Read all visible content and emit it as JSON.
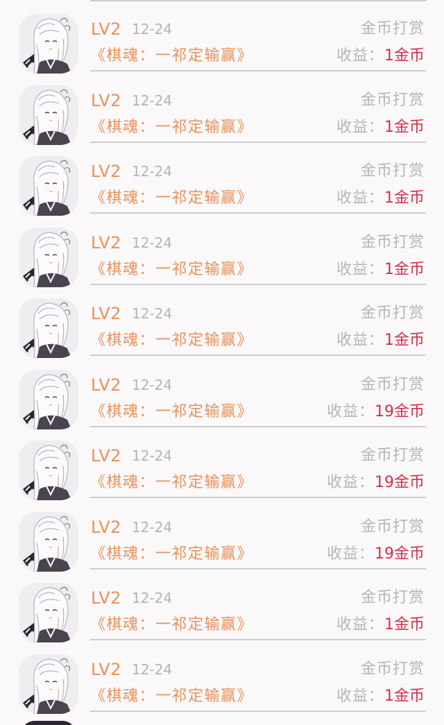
{
  "rows": [
    {
      "level": "LV2",
      "date": "12-24",
      "reward_type": "金币打赏",
      "title": "《棋魂：一祁定输赢》",
      "income_label": "收益：",
      "income_amount": "1",
      "income_unit": "金币"
    },
    {
      "level": "LV2",
      "date": "12-24",
      "reward_type": "金币打赏",
      "title": "《棋魂：一祁定输赢》",
      "income_label": "收益：",
      "income_amount": "1",
      "income_unit": "金币"
    },
    {
      "level": "LV2",
      "date": "12-24",
      "reward_type": "金币打赏",
      "title": "《棋魂：一祁定输赢》",
      "income_label": "收益：",
      "income_amount": "1",
      "income_unit": "金币"
    },
    {
      "level": "LV2",
      "date": "12-24",
      "reward_type": "金币打赏",
      "title": "《棋魂：一祁定输赢》",
      "income_label": "收益：",
      "income_amount": "1",
      "income_unit": "金币"
    },
    {
      "level": "LV2",
      "date": "12-24",
      "reward_type": "金币打赏",
      "title": "《棋魂：一祁定输赢》",
      "income_label": "收益：",
      "income_amount": "1",
      "income_unit": "金币"
    },
    {
      "level": "LV2",
      "date": "12-24",
      "reward_type": "金币打赏",
      "title": "《棋魂：一祁定输赢》",
      "income_label": "收益：",
      "income_amount": "19",
      "income_unit": "金币"
    },
    {
      "level": "LV2",
      "date": "12-24",
      "reward_type": "金币打赏",
      "title": "《棋魂：一祁定输赢》",
      "income_label": "收益：",
      "income_amount": "19",
      "income_unit": "金币"
    },
    {
      "level": "LV2",
      "date": "12-24",
      "reward_type": "金币打赏",
      "title": "《棋魂：一祁定输赢》",
      "income_label": "收益：",
      "income_amount": "19",
      "income_unit": "金币"
    },
    {
      "level": "LV2",
      "date": "12-24",
      "reward_type": "金币打赏",
      "title": "《棋魂：一祁定输赢》",
      "income_label": "收益：",
      "income_amount": "1",
      "income_unit": "金币"
    },
    {
      "level": "LV2",
      "date": "12-24",
      "reward_type": "金币打赏",
      "title": "《棋魂：一祁定输赢》",
      "income_label": "收益：",
      "income_amount": "1",
      "income_unit": "金币"
    }
  ],
  "colors": {
    "level": "#e8915a",
    "title": "#e8915a",
    "muted": "#b7b5b7",
    "amount": "#d0314a",
    "divider": "#cfcccd",
    "background": "#faf8f9"
  },
  "icons": {
    "avatar": "user-avatar-illustration"
  }
}
